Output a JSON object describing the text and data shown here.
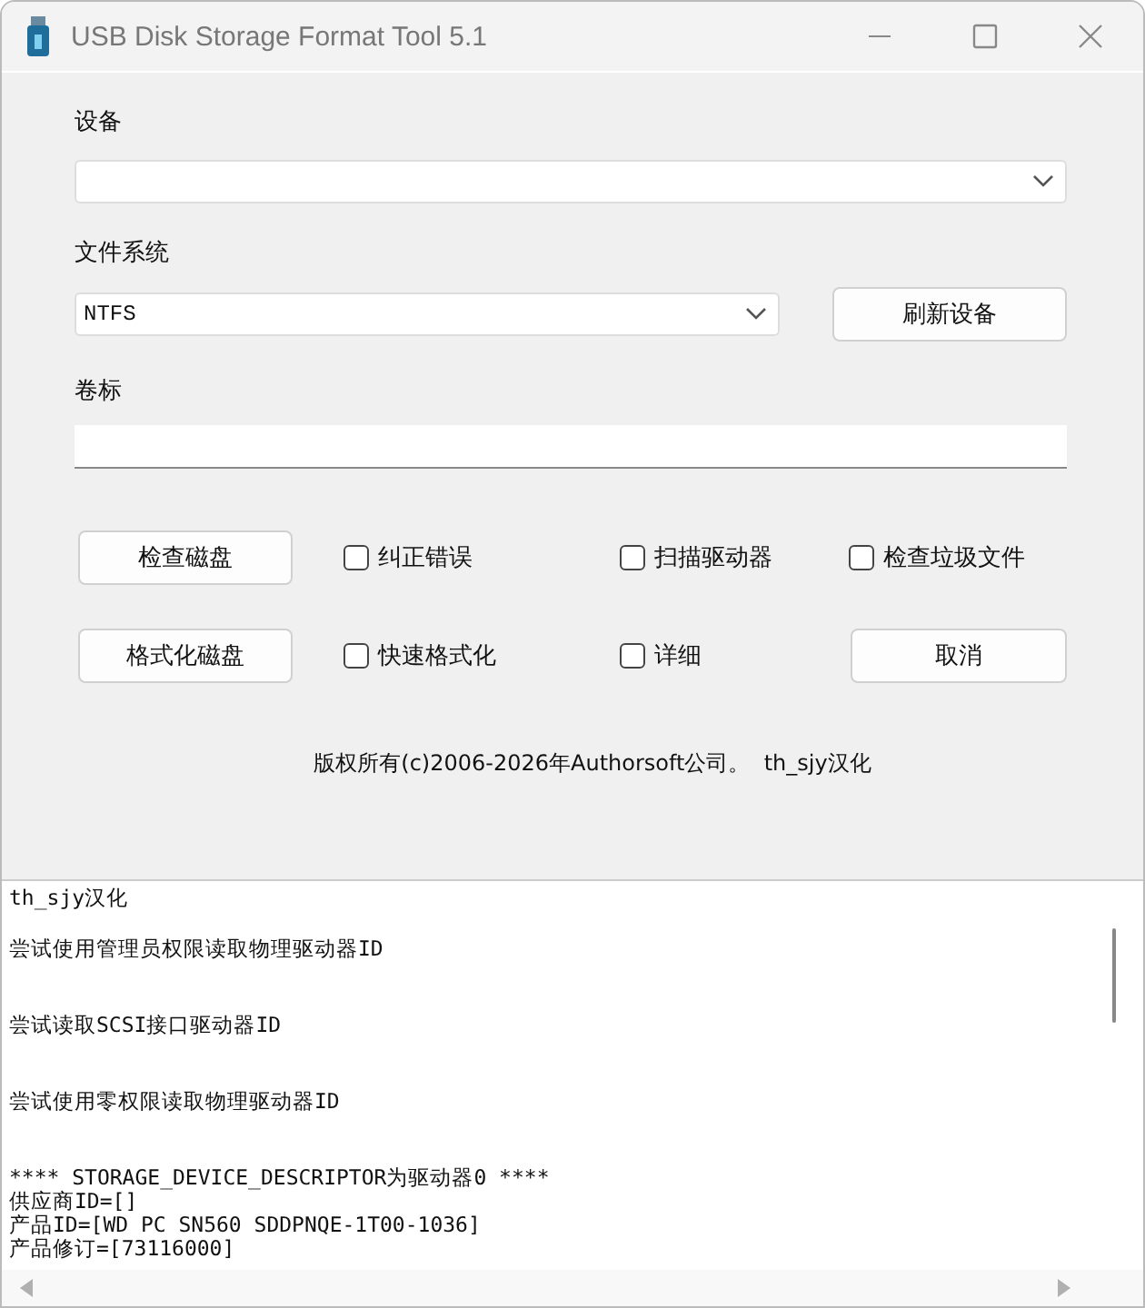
{
  "window": {
    "title": "USB Disk Storage Format Tool 5.1"
  },
  "device": {
    "label": "设备"
  },
  "file_system": {
    "label": "文件系统",
    "value": "NTFS"
  },
  "refresh_button": "刷新设备",
  "volume_label": {
    "label": "卷标"
  },
  "row_1": {
    "button": "检查磁盘",
    "options": [
      {
        "label": "纠正错误",
        "checked": false
      },
      {
        "label": "扫描驱动器",
        "checked": false
      },
      {
        "label": "检查垃圾文件",
        "checked": false
      }
    ]
  },
  "row_2": {
    "button": "格式化磁盘",
    "options": [
      {
        "label": "快速格式化",
        "checked": false
      },
      {
        "label": "详细",
        "checked": false
      }
    ],
    "cancel_button": "取消"
  },
  "copyright": "版权所有(c)2006-2026年Authorsoft公司。  th_sjy汉化",
  "log": [
    [
      "th_sjy汉化"
    ],
    [
      "尝试使用管理员权限读取物理驱动器ID"
    ],
    [
      "尝试读取SCSI接口驱动器ID"
    ],
    [
      "尝试使用零权限读取物理驱动器ID"
    ],
    [
      "**** STORAGE_DEVICE_DESCRIPTOR为驱动器0 ****",
      "供应商ID=[]",
      "产品ID=[WD PC SN560 SDDPNQE-1T00-1036]",
      "产品修订=[73116000]"
    ]
  ]
}
